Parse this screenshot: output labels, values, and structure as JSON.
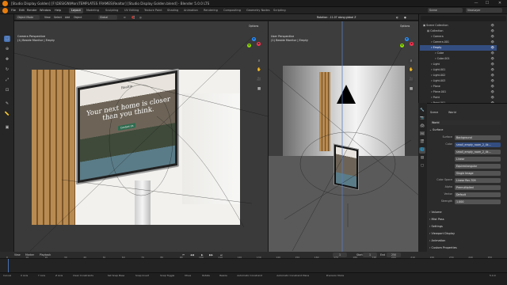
{
  "window": {
    "title": "[Studio Display Golden] [F:\\DESIGN\\Mon\\TEMPLATES FRAMES\\Realtor] [Studio Display Golden.blend] - Blender 5.0.0 LTS",
    "minimize": "—",
    "maximize": "☐",
    "close": "✕"
  },
  "menu": {
    "items": [
      "File",
      "Edit",
      "Render",
      "Window",
      "Help"
    ],
    "workspaces": [
      "Layout",
      "Modeling",
      "Sculpting",
      "UV Editing",
      "Texture Paint",
      "Shading",
      "Animation",
      "Rendering",
      "Compositing",
      "Geometry Nodes",
      "Scripting"
    ],
    "active_workspace": "Layout",
    "scene": "Scene",
    "view_layer": "ViewLayer"
  },
  "viewport_left": {
    "mode": "Object Mode",
    "menus": [
      "View",
      "Select",
      "Add",
      "Object"
    ],
    "transform": "Global",
    "perspective": "Camera Perspective",
    "collection": "(1) Beside Monitor | Empty",
    "options": "Options"
  },
  "viewport_right": {
    "perspective": "User Perspective",
    "collection": "(1) Beside Monitor | Empty",
    "info": "Rotation: -11.07 along global Z",
    "options": "Options"
  },
  "website": {
    "brand": "Realtia",
    "headline": "Your next home is closer than you think.",
    "cta": "Contact Us"
  },
  "outliner": {
    "search_placeholder": "",
    "items": [
      {
        "name": "Scene Collection",
        "indent": 0,
        "selected": false
      },
      {
        "name": "Collection",
        "indent": 1,
        "selected": false
      },
      {
        "name": "Camera",
        "indent": 2,
        "selected": false
      },
      {
        "name": "Camera.001",
        "indent": 2,
        "selected": false
      },
      {
        "name": "Empty",
        "indent": 2,
        "selected": true
      },
      {
        "name": "Cube",
        "indent": 3,
        "selected": false
      },
      {
        "name": "Cube.001",
        "indent": 3,
        "selected": false
      },
      {
        "name": "Light",
        "indent": 2,
        "selected": false
      },
      {
        "name": "Light.001",
        "indent": 2,
        "selected": false
      },
      {
        "name": "Light.002",
        "indent": 2,
        "selected": false
      },
      {
        "name": "Light.003",
        "indent": 2,
        "selected": false
      },
      {
        "name": "Plane",
        "indent": 2,
        "selected": false
      },
      {
        "name": "Plane.001",
        "indent": 2,
        "selected": false
      },
      {
        "name": "Point",
        "indent": 2,
        "selected": false
      },
      {
        "name": "Point.001",
        "indent": 2,
        "selected": false
      }
    ]
  },
  "properties": {
    "breadcrumb_scene": "Scene",
    "breadcrumb_world": "World",
    "world_name": "World",
    "sections": {
      "surface": "Surface",
      "volume": "Volume",
      "mist": "Mist Pass",
      "settings": "Settings",
      "viewport": "Viewport Display",
      "animation": "Animation",
      "custom": "Custom Properties"
    },
    "rows": [
      {
        "label": "Surface",
        "value": "Background"
      },
      {
        "label": "Color",
        "value": "small_empty_room_2_4k..."
      },
      {
        "label": "",
        "value": "small_empty_room_2_4k..."
      },
      {
        "label": "",
        "value": "Linear"
      },
      {
        "label": "",
        "value": "Equirectangular"
      },
      {
        "label": "",
        "value": "Single Image"
      },
      {
        "label": "Color Space",
        "value": "Linear Rec.709"
      },
      {
        "label": "Alpha",
        "value": "Premultiplied"
      },
      {
        "label": "Vector",
        "value": "Default"
      },
      {
        "label": "Strength",
        "value": "1.000"
      }
    ]
  },
  "timeline": {
    "menus": [
      "View",
      "Marker",
      "Playback"
    ],
    "current_frame": "1",
    "start_label": "Start",
    "start": "1",
    "end_label": "End",
    "end": "250",
    "ticks": [
      "0",
      "10",
      "20",
      "30",
      "40",
      "50",
      "60",
      "70",
      "80",
      "90",
      "100",
      "110",
      "120",
      "130",
      "140",
      "150",
      "160",
      "170",
      "180",
      "190",
      "200",
      "210",
      "220",
      "230",
      "240",
      "250"
    ]
  },
  "statusbar": {
    "items": [
      "Cancel",
      "X Axis",
      "Y Axis",
      "Z Axis",
      "Clear Constraints",
      "Set Snap Base",
      "Snap Invert",
      "Snap Toggle",
      "Move",
      "Rotate",
      "Resize",
      "Automatic Constraint",
      "Automatic Constraint Plane",
      "Precision Mode"
    ],
    "version": "5.0.0"
  },
  "colors": {
    "accent": "#4772b3",
    "selected": "#334d80",
    "x_axis": "#ff3352",
    "y_axis": "#8bdc00",
    "z_axis": "#2890ff"
  }
}
